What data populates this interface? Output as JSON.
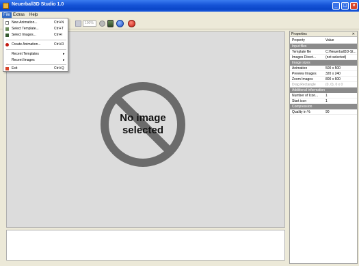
{
  "window": {
    "title": "Neuerball3D Studio 1.0"
  },
  "menubar": {
    "items": [
      "File",
      "Extras",
      "Help"
    ]
  },
  "toolbar": {
    "zoom_value": "100%"
  },
  "file_menu": {
    "items": [
      {
        "label": "New Animation...",
        "shortcut": "Ctrl+N",
        "icon": "new-doc-icon"
      },
      {
        "label": "Select Template...",
        "shortcut": "Ctrl+T",
        "icon": "template-icon"
      },
      {
        "label": "Select Images...",
        "shortcut": "Ctrl+I",
        "icon": "images-icon"
      },
      {
        "label": "Create Animation...",
        "shortcut": "Ctrl+R",
        "icon": "create-icon"
      },
      {
        "label": "Recent Templates",
        "shortcut": "",
        "icon": ""
      },
      {
        "label": "Recent Images",
        "shortcut": "",
        "icon": ""
      },
      {
        "label": "Exit",
        "shortcut": "Ctrl+Q",
        "icon": "exit-icon"
      }
    ]
  },
  "canvas": {
    "placeholder_line1": "No image",
    "placeholder_line2": "selected"
  },
  "properties": {
    "title": "Properties",
    "pin": "✕",
    "col_property": "Property",
    "col_value": "Value",
    "sections": [
      {
        "name": "Input files",
        "rows": [
          {
            "key": "Template file",
            "value": "C:\\Neuerball3D-St...",
            "disabled": false
          },
          {
            "key": "Images Direct...",
            "value": "(not selected)",
            "disabled": false
          }
        ]
      },
      {
        "name": "Image sizes",
        "rows": [
          {
            "key": "Animation",
            "value": "500 x 500",
            "disabled": false
          },
          {
            "key": "Preview Images",
            "value": "320 x 240",
            "disabled": false
          },
          {
            "key": "Zoom Images",
            "value": "800 x 600",
            "disabled": false
          },
          {
            "key": "Drag Rectangle",
            "value": "(0, 0), 0 x 0",
            "disabled": true
          }
        ]
      },
      {
        "name": "Additional information",
        "rows": [
          {
            "key": "Number of Icon...",
            "value": "1",
            "disabled": false
          },
          {
            "key": "Start icon",
            "value": "1",
            "disabled": false
          }
        ]
      },
      {
        "name": "Compression",
        "rows": [
          {
            "key": "Quality in %",
            "value": "90",
            "disabled": false
          }
        ]
      }
    ]
  },
  "colors": {
    "accent": "#316ac5",
    "titlebar": "#0a46c8",
    "category": "#8b8b8b"
  }
}
